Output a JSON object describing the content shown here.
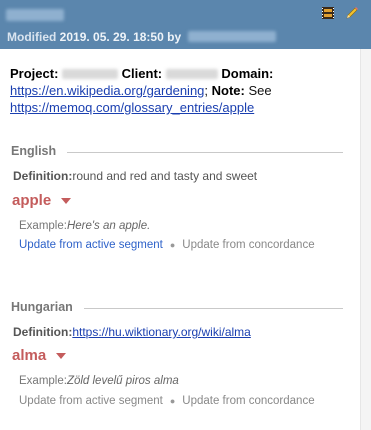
{
  "header": {
    "modified_label": "Modified",
    "modified_date": "2019. 05. 29. 18:50",
    "by_label": "by",
    "icons": [
      "film-icon",
      "pencil-icon"
    ]
  },
  "summary": {
    "project_label": "Project:",
    "client_label": "Client:",
    "domain_label": "Domain:",
    "domain_link": "https://en.wikipedia.org/gardening",
    "note_label": "Note:",
    "note_text": "See",
    "note_link": "https://memoq.com/glossary_entries/apple"
  },
  "entries": [
    {
      "language": "English",
      "definition_label": "Definition:",
      "definition_text": "round and red and tasty and sweet",
      "term": "apple",
      "example_label": "Example:",
      "example_text": "Here's an apple.",
      "action_1": "Update from active segment",
      "action_2": "Update from concordance"
    },
    {
      "language": "Hungarian",
      "definition_label": "Definition:",
      "definition_link": "https://hu.wiktionary.org/wiki/alma",
      "term": "alma",
      "example_label": "Example:",
      "example_text": "Zöld levelű piros alma",
      "action_1": "Update from active segment",
      "action_2": "Update from concordance"
    }
  ],
  "colors": {
    "header_bg": "#5b86ad",
    "term_red": "#c45c5c",
    "link_blue": "#1a3fb0"
  }
}
